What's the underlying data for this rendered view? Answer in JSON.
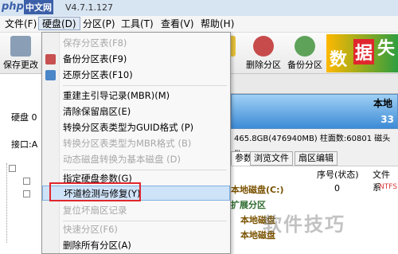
{
  "titlebar": {
    "logo_php": "php",
    "logo_cn": "中文网",
    "version": "V4.7.1.127"
  },
  "menubar": {
    "items": [
      "文件(F)",
      "硬盘(D)",
      "分区(P)",
      "工具(T)",
      "查看(V)",
      "帮助(H)"
    ]
  },
  "toolbar": {
    "save_label": "保存更改",
    "delete_partition": "删除分区",
    "backup_partition": "备份分区",
    "partial_label": "化",
    "banner_chars": [
      "数",
      "据",
      "失"
    ]
  },
  "left": {
    "disk_label": "硬盘 0",
    "port_label": "接口:A",
    "colon": ":"
  },
  "disk": {
    "local_label": "本地",
    "size_partial": "33",
    "info": "465.8GB(476940MB) 柱面数:60801 磁头数"
  },
  "tabs": [
    "参数",
    "浏览文件",
    "扇区编辑"
  ],
  "table": {
    "headers": [
      "序号(状态)",
      "文件系"
    ],
    "rows": [
      {
        "name": "本地磁盘(C:)",
        "num": "0",
        "fs": "NTFS"
      },
      {
        "name": "扩展分区",
        "num": "",
        "fs": ""
      },
      {
        "name": "本地磁盘",
        "num": "",
        "fs": ""
      },
      {
        "name": "本地磁盘",
        "num": "",
        "fs": ""
      }
    ]
  },
  "dropdown": {
    "items": [
      {
        "label": "保存分区表(F8)",
        "disabled": true
      },
      {
        "label": "备份分区表(F9)",
        "disabled": false
      },
      {
        "label": "还原分区表(F10)",
        "disabled": false
      },
      {
        "label": "重建主引导记录(MBR)(M)",
        "disabled": false
      },
      {
        "label": "清除保留扇区(E)",
        "disabled": false
      },
      {
        "label": "转换分区表类型为GUID格式 (P)",
        "disabled": false
      },
      {
        "label": "转换分区表类型为MBR格式 (B)",
        "disabled": true
      },
      {
        "label": "动态磁盘转换为基本磁盘 (D)",
        "disabled": true
      },
      {
        "label": "指定硬盘参数(G)",
        "disabled": false
      },
      {
        "label": "坏道检测与修复(Y)",
        "disabled": false,
        "highlighted": true
      },
      {
        "label": "复位坏扇区记录",
        "disabled": true
      },
      {
        "label": "快速分区(F6)",
        "disabled": true
      },
      {
        "label": "删除所有分区(A)",
        "disabled": false
      }
    ]
  },
  "watermark": "软件技巧",
  "colors": {
    "accent": "#e0272d",
    "highlight": "#cfe3f8"
  }
}
